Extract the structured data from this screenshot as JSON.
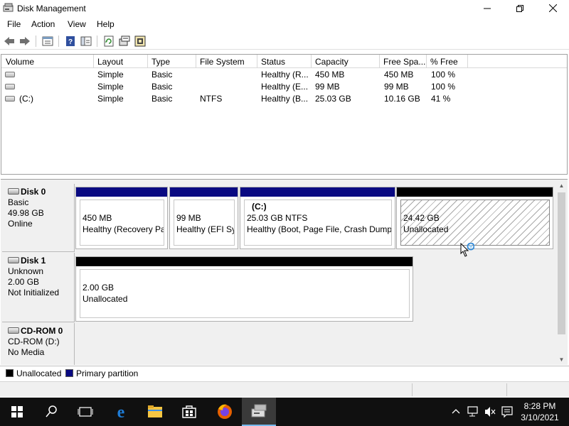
{
  "window": {
    "title": "Disk Management",
    "minimize_icon": "minimize-icon",
    "maximize_icon": "restore-icon",
    "close_icon": "close-icon"
  },
  "menu": [
    "File",
    "Action",
    "View",
    "Help"
  ],
  "toolbar": {
    "buttons": [
      "back-icon",
      "forward-icon",
      "properties-pane-icon",
      "help-icon",
      "console-tree-icon",
      "refresh-icon",
      "rescan-disks-icon",
      "settings-icon"
    ]
  },
  "volume_table": {
    "columns": [
      "Volume",
      "Layout",
      "Type",
      "File System",
      "Status",
      "Capacity",
      "Free Spa...",
      "% Free"
    ],
    "rows": [
      {
        "volume": "",
        "layout": "Simple",
        "type": "Basic",
        "fs": "",
        "status": "Healthy (R...",
        "capacity": "450 MB",
        "free": "450 MB",
        "pct": "100 %"
      },
      {
        "volume": "",
        "layout": "Simple",
        "type": "Basic",
        "fs": "",
        "status": "Healthy (E...",
        "capacity": "99 MB",
        "free": "99 MB",
        "pct": "100 %"
      },
      {
        "volume": "(C:)",
        "layout": "Simple",
        "type": "Basic",
        "fs": "NTFS",
        "status": "Healthy (B...",
        "capacity": "25.03 GB",
        "free": "10.16 GB",
        "pct": "41 %"
      }
    ]
  },
  "disks": [
    {
      "name": "Disk 0",
      "type": "Basic",
      "size": "49.98 GB",
      "state": "Online",
      "partitions": [
        {
          "title": "",
          "line1": "450 MB",
          "line2": "Healthy (Recovery Par",
          "kind": "primary"
        },
        {
          "title": "",
          "line1": "99 MB",
          "line2": "Healthy (EFI Sys",
          "kind": "primary"
        },
        {
          "title": "(C:)",
          "line1": "25.03 GB NTFS",
          "line2": "Healthy (Boot, Page File, Crash Dump,",
          "kind": "primary"
        },
        {
          "title": "",
          "line1": "24.42 GB",
          "line2": "Unallocated",
          "kind": "unallocated"
        }
      ]
    },
    {
      "name": "Disk 1",
      "type": "Unknown",
      "size": "2.00 GB",
      "state": "Not Initialized",
      "partitions": [
        {
          "title": "",
          "line1": "2.00 GB",
          "line2": "Unallocated",
          "kind": "unallocated"
        }
      ]
    },
    {
      "name": "CD-ROM 0",
      "type": "CD-ROM (D:)",
      "size": "",
      "state": "No Media",
      "partitions": []
    }
  ],
  "legend": [
    {
      "label": "Unallocated",
      "color": "#000000"
    },
    {
      "label": "Primary partition",
      "color": "#0a0a82"
    }
  ],
  "taskbar": {
    "items": [
      "start-icon",
      "search-icon",
      "task-view-icon",
      "edge-icon",
      "file-explorer-icon",
      "store-icon",
      "firefox-icon",
      "disk-management-icon"
    ],
    "time": "8:28 PM",
    "date": "3/10/2021"
  }
}
